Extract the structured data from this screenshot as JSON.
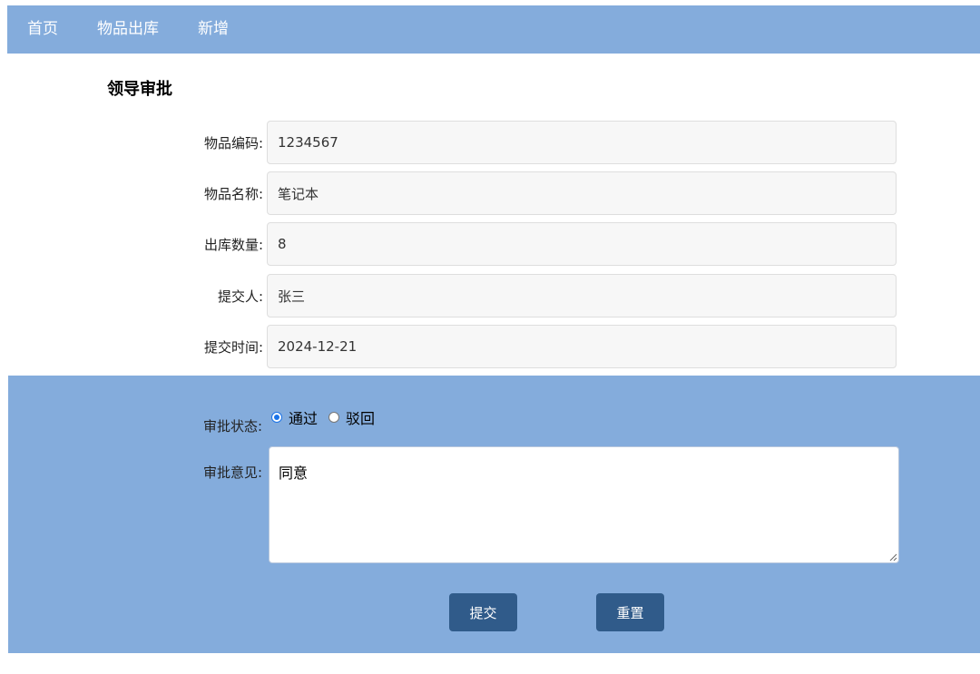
{
  "nav": {
    "items": [
      "首页",
      "物品出库",
      "新增"
    ]
  },
  "page_title": "领导审批",
  "fields": [
    {
      "label": "物品编码:",
      "value": "1234567"
    },
    {
      "label": "物品名称:",
      "value": "笔记本"
    },
    {
      "label": "出库数量:",
      "value": "8"
    },
    {
      "label": "提交人:",
      "value": "张三"
    },
    {
      "label": "提交时间:",
      "value": "2024-12-21"
    }
  ],
  "approval": {
    "status_label": "审批状态:",
    "options": [
      "通过",
      "驳回"
    ],
    "selected": "通过",
    "comment_label": "审批意见:",
    "comment_value": "同意"
  },
  "buttons": {
    "submit": "提交",
    "reset": "重置"
  },
  "colors": {
    "panel": "#84acdc",
    "button": "#305b8a"
  }
}
